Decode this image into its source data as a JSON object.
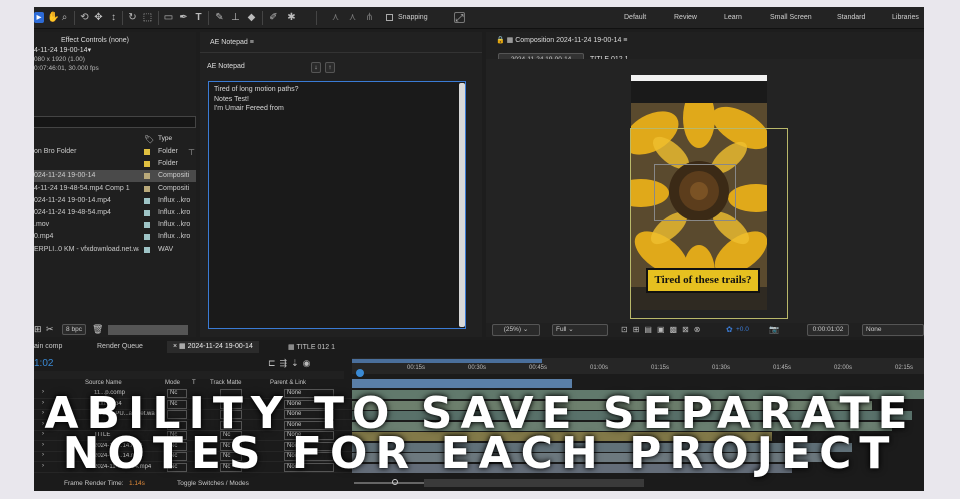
{
  "workspaces": [
    "Default",
    "Review",
    "Learn",
    "Small Screen",
    "Standard",
    "Libraries"
  ],
  "toolbar": {
    "snapping_label": "Snapping"
  },
  "project_panel": {
    "effect_controls_tab": "Effect Controls (none)",
    "comp_name": "4-11-24 19-00-14▾",
    "comp_size": "080 x 1920 (1.00)",
    "comp_duration": "0:07:46:01, 30.000 fps",
    "type_header": "Type",
    "items": [
      {
        "name": "on Bro Folder",
        "type": "Folder",
        "color": "#e0c040"
      },
      {
        "name": "",
        "type": "Folder",
        "color": "#e0c040"
      },
      {
        "name": "024-11-24 19-00-14",
        "type": "Compositi",
        "color": "#b9a97a"
      },
      {
        "name": "4-11-24 19-48-54.mp4 Comp 1",
        "type": "Compositi",
        "color": "#b9a97a"
      },
      {
        "name": "024-11-24 19-00-14.mp4",
        "type": "Influx ..kro",
        "color": "#9ec4c6"
      },
      {
        "name": "024-11-24 19-48-54.mp4",
        "type": "Influx ..kro",
        "color": "#9ec4c6"
      },
      {
        "name": ".mov",
        "type": "Influx ..kro",
        "color": "#9ec4c6"
      },
      {
        "name": "0.mp4",
        "type": "Influx ..kro",
        "color": "#9ec4c6"
      },
      {
        "name": "ERPLI..0 KM - vfxdownload.net.wav",
        "type": "WAV",
        "color": "#9ec4c6"
      }
    ],
    "bpc": "8 bpc"
  },
  "notepad": {
    "tab": "AE Notepad",
    "title": "AE Notepad",
    "text": "Tired of long motion paths?\nNotes Test!\nI'm Umair Fereed from"
  },
  "comp_viewer": {
    "tab": "Composition 2024-11-24 19-00-14",
    "breadcrumb_comp": "2024-11-24 19-00-14",
    "breadcrumb_layer": "TITLE 012 1",
    "overlay_text": "Tired of these trails?",
    "zoom": "(25%)",
    "resolution": "Full",
    "exposure": "+0.0",
    "timecode": "0:00:01:02",
    "view": "None"
  },
  "timeline": {
    "tabs": [
      "ain comp",
      "Render Queue",
      "2024-11-24 19-00-14",
      "TITLE 012 1"
    ],
    "current_time": "1:02",
    "columns": [
      "Source Name",
      "Mode",
      "T",
      "Track Matte",
      "Parent & Link"
    ],
    "ruler": [
      "00:15s",
      "00:30s",
      "00:45s",
      "01:00s",
      "01:15s",
      "01:30s",
      "01:45s",
      "02:00s",
      "02:15s"
    ],
    "layers": [
      {
        "name": "11...p.comp",
        "mode": "Nc",
        "matte": "",
        "parent": "None"
      },
      {
        "name": "Outl...mp4",
        "mode": "Nc",
        "matte": "Nc",
        "parent": "None"
      },
      {
        "name": "CYBE...PU...a...net.wa",
        "mode": "",
        "matte": "",
        "parent": "None"
      },
      {
        "name": ".mov",
        "mode": "Nc",
        "matte": "Nc",
        "parent": "None"
      },
      {
        "name": "TITLE",
        "mode": "Nc",
        "matte": "Nc",
        "parent": "None"
      },
      {
        "name": "2024-11-...14.mp4",
        "mode": "Nc",
        "matte": "Nc",
        "parent": "None"
      },
      {
        "name": "2024-11-...14.mp4",
        "mode": "Nc",
        "matte": "Nc",
        "parent": "None"
      },
      {
        "name": "2024-11-...00-14.mp4",
        "mode": "Nc",
        "matte": "Nc",
        "parent": "None"
      }
    ],
    "render_time_label": "Frame Render Time:",
    "render_time_value": "1.14s",
    "toggle_label": "Toggle Switches / Modes"
  },
  "caption": {
    "line1": "ABILITY TO SAVE SEPARATE",
    "line2": "NOTES FOR EACH PROJECT"
  },
  "colors": {
    "accent": "#2d6bd6",
    "notepad_border": "#3a7bd5",
    "overlay_box": "#e6c020",
    "render_time": "#e08a3a"
  }
}
